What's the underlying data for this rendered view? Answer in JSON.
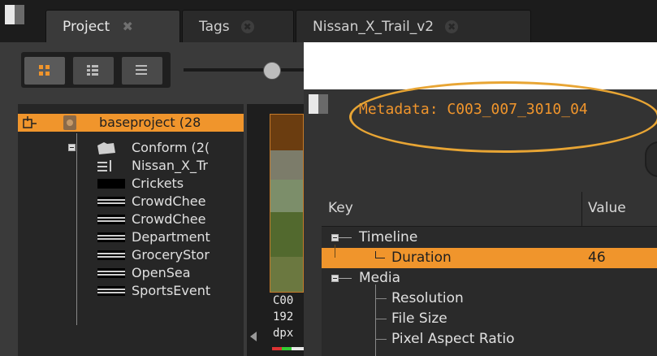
{
  "tabs": [
    {
      "label": "Project",
      "active": true
    },
    {
      "label": "Tags",
      "active": false
    },
    {
      "label": "Nissan_X_Trail_v2",
      "active": false
    }
  ],
  "toolbar": {
    "view_modes": [
      "grid-view-icon",
      "list-detail-view-icon",
      "list-view-icon"
    ],
    "selected_view": "grid-view-icon"
  },
  "tree": {
    "root": "baseproject (28",
    "items": [
      {
        "label": "Conform (2(",
        "icon": "folder-icon"
      },
      {
        "label": "Nissan_X_Tr",
        "icon": "sequence-icon"
      },
      {
        "label": "Crickets",
        "icon": "audio-waveform-icon"
      },
      {
        "label": "CrowdChee",
        "icon": "audio-waveform-icon"
      },
      {
        "label": "CrowdChee",
        "icon": "audio-waveform-icon"
      },
      {
        "label": "Department",
        "icon": "audio-waveform-icon"
      },
      {
        "label": "GroceryStor",
        "icon": "audio-waveform-icon"
      },
      {
        "label": "OpenSea",
        "icon": "audio-waveform-icon"
      },
      {
        "label": "SportsEvent",
        "icon": "audio-waveform-icon"
      }
    ]
  },
  "thumbnail": {
    "line1": "C00",
    "line2": "192",
    "line3": "dpx"
  },
  "metadata": {
    "title": "Metadata: C003_007_3010_04",
    "columns": {
      "key": "Key",
      "value": "Value"
    },
    "rows": [
      {
        "key": "Timeline",
        "value": "",
        "level": 0,
        "group": true
      },
      {
        "key": "Duration",
        "value": "46",
        "level": 1,
        "selected": true
      },
      {
        "key": "Media",
        "value": "",
        "level": 0,
        "group": true
      },
      {
        "key": "Resolution",
        "value": "",
        "level": 1
      },
      {
        "key": "File Size",
        "value": "",
        "level": 1
      },
      {
        "key": "Pixel Aspect Ratio",
        "value": "",
        "level": 1
      }
    ]
  },
  "colors": {
    "accent": "#f0952c",
    "highlight_ring": "#e8a534",
    "background": "#2b2b2b"
  }
}
